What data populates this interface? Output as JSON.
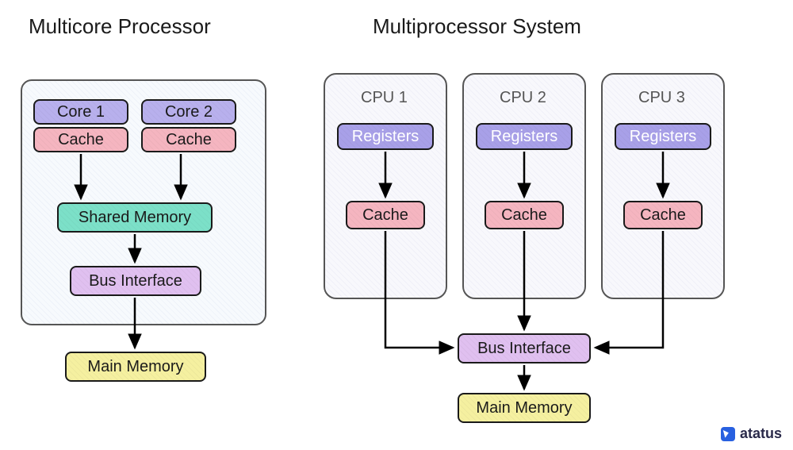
{
  "left": {
    "title": "Multicore Processor",
    "core1": "Core 1",
    "core2": "Core 2",
    "cache": "Cache",
    "shared": "Shared Memory",
    "bus": "Bus Interface",
    "main": "Main Memory"
  },
  "right": {
    "title": "Multiprocessor System",
    "cpu1": "CPU 1",
    "cpu2": "CPU 2",
    "cpu3": "CPU 3",
    "registers": "Registers",
    "cache": "Cache",
    "bus": "Bus Interface",
    "main": "Main Memory"
  },
  "brand": "atatus",
  "colors": {
    "core": "#b8b0ed",
    "cache": "#f5b5c0",
    "shared": "#7ce0c8",
    "bus": "#e0c0f0",
    "main": "#f5f0a0",
    "registers": "#a8a0e8"
  }
}
